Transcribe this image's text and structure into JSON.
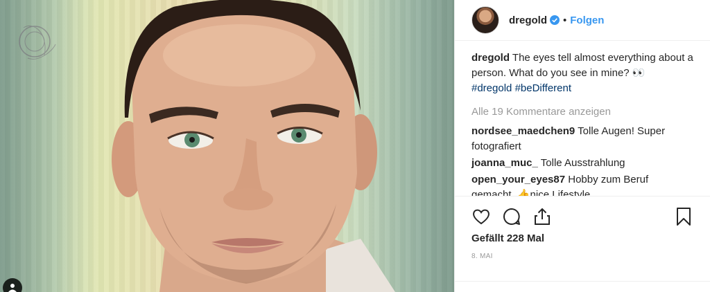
{
  "header": {
    "username": "dregold",
    "verified_icon": "verified-badge-icon",
    "separator": "•",
    "follow_label": "Folgen"
  },
  "caption": {
    "username": "dregold",
    "text": "The eyes tell almost everything about a person. What do you see in mine? 👀",
    "hashtags": [
      "#dregold",
      "#beDifferent"
    ]
  },
  "view_all_comments": "Alle 19 Kommentare anzeigen",
  "comments": [
    {
      "username": "nordsee_maedchen9",
      "text": "Tolle Augen! Super fotografiert"
    },
    {
      "username": "joanna_muc_",
      "text": "Tolle Ausstrahlung"
    },
    {
      "username": "open_your_eyes87",
      "text": "Hobby zum Beruf gemacht. 👍nice Lifestyle"
    }
  ],
  "actions": {
    "like_icon": "heart-icon",
    "comment_icon": "comment-bubble-icon",
    "share_icon": "share-icon",
    "save_icon": "bookmark-icon"
  },
  "likes": "Gefällt 228 Mal",
  "date": "8. MAI",
  "colors": {
    "link_blue": "#3897f0",
    "hashtag": "#003569",
    "muted": "#999999",
    "text": "#262626"
  }
}
